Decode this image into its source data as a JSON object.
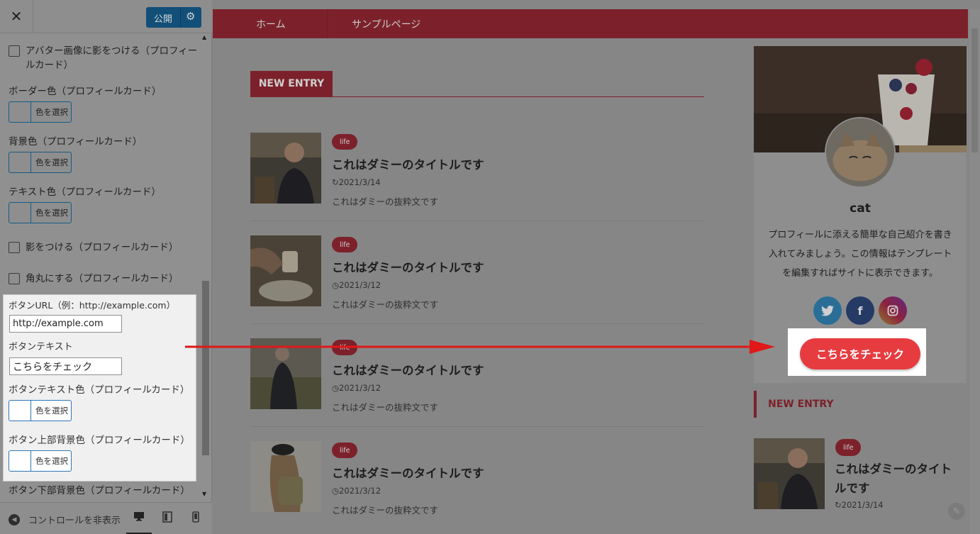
{
  "panel": {
    "close": "✕",
    "publish_label": "公開",
    "controls": {
      "avatar_shadow_label": "アバター画像に影をつける（プロフィー",
      "avatar_shadow_label2": "ルカード）",
      "border_color_label": "ボーダー色（プロフィールカード）",
      "bg_color_label": "背景色（プロフィールカード）",
      "text_color_label": "テキスト色（プロフィールカード）",
      "shadow_label": "影をつける（プロフィールカード）",
      "rounded_label": "角丸にする（プロフィールカード）",
      "button_url_label": "ボタンURL（例：http://example.com）",
      "button_url_value": "http://example.com",
      "button_text_label": "ボタンテキスト",
      "button_text_value": "こちらをチェック",
      "button_text_color_label": "ボタンテキスト色（プロフィールカード）",
      "button_top_bg_label": "ボタン上部背景色（プロフィールカード）",
      "button_bottom_bg_label": "ボタン下部背景色（プロフィールカード）",
      "select_color": "色を選択"
    },
    "footer": {
      "hide_controls": "コントロールを非表示"
    }
  },
  "nav": {
    "items": [
      "ホーム",
      "サンプルページ"
    ]
  },
  "main": {
    "section_title": "NEW ENTRY",
    "entries": [
      {
        "badge": "life",
        "title": "これはダミーのタイトルです",
        "date": "2021/3/14",
        "excerpt": "これはダミーの抜粋文です"
      },
      {
        "badge": "life",
        "title": "これはダミーのタイトルです",
        "date": "2021/3/12",
        "excerpt": "これはダミーの抜粋文です"
      },
      {
        "badge": "life",
        "title": "これはダミーのタイトルです",
        "date": "2021/3/12",
        "excerpt": "これはダミーの抜粋文です"
      },
      {
        "badge": "life",
        "title": "これはダミーのタイトルです",
        "date": "2021/3/12",
        "excerpt": "これはダミーの抜粋文です"
      }
    ]
  },
  "sidebar": {
    "profile": {
      "name": "cat",
      "text": "プロフィールに添える簡単な自己紹介を書き入れてみましょう。この情報はテンプレートを編集すればサイトに表示できます。",
      "button": "こちらをチェック"
    },
    "section_title": "NEW ENTRY",
    "entry": {
      "badge": "life",
      "title": "これはダミーのタイトルです",
      "date": "2021/3/14"
    }
  },
  "colors": {
    "accent": "#7c212b",
    "cta": "#e63c40",
    "arrow": "#e01818"
  }
}
